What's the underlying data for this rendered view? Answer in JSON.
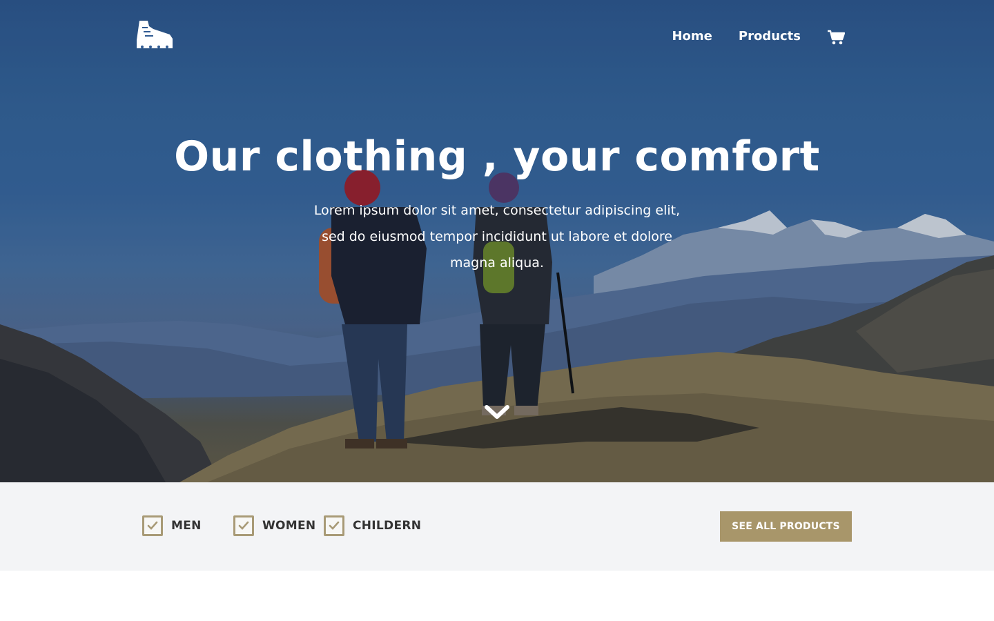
{
  "nav": {
    "logo_icon": "hiking-boot-icon",
    "links": [
      {
        "label": "Home"
      },
      {
        "label": "Products"
      }
    ],
    "cart_icon": "shopping-cart-icon"
  },
  "hero": {
    "title": "Our clothing , your comfort",
    "subtitle": "Lorem ipsum dolor sit amet, consectetur adipiscing elit, sed do eiusmod tempor incididunt ut labore et dolore magna aliqua.",
    "scroll_icon": "chevron-down-icon"
  },
  "filters": [
    {
      "label": "MEN",
      "checked": true
    },
    {
      "label": "WOMEN",
      "checked": true
    },
    {
      "label": "CHILDERN",
      "checked": true
    }
  ],
  "cta": {
    "label": "SEE ALL PRODUCTS"
  },
  "colors": {
    "accent": "#a8966a",
    "filter_bar_bg": "#f3f4f6",
    "hero_sky": "#2f5a92",
    "text_dark": "#333333"
  }
}
